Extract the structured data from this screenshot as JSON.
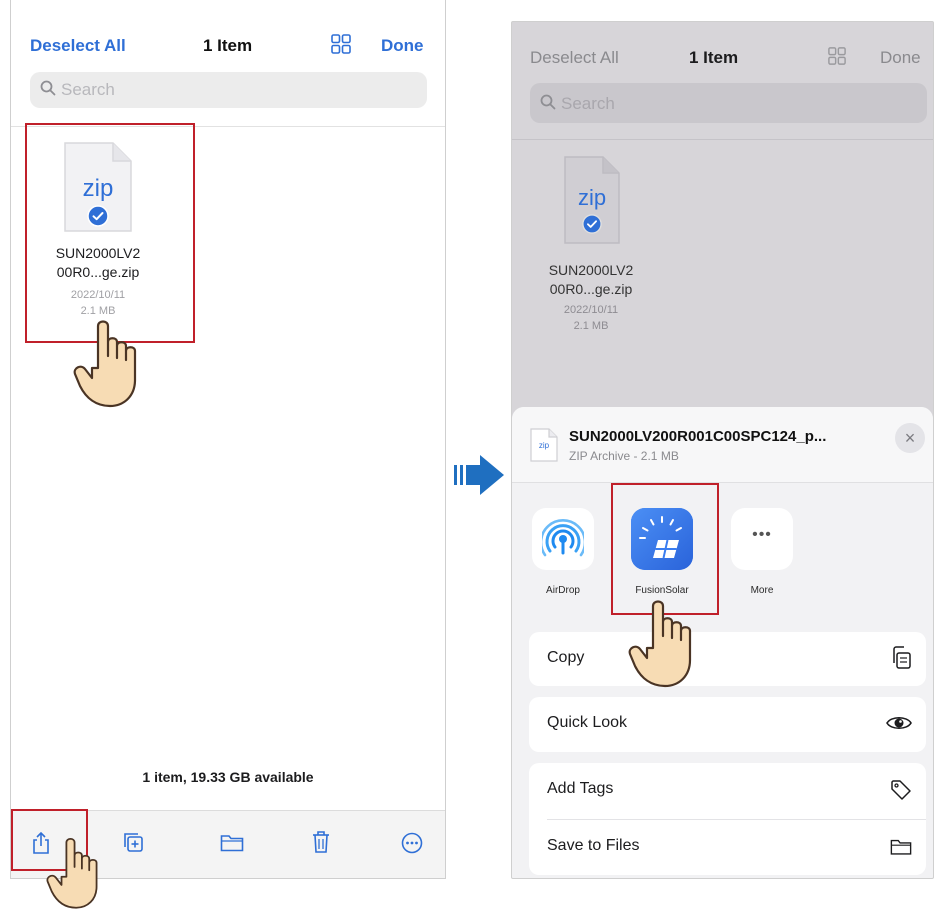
{
  "screen_left": {
    "nav": {
      "deselect_all": "Deselect All",
      "title": "1 Item",
      "done": "Done",
      "grid_icon": "grid-view-icon"
    },
    "search": {
      "placeholder": "Search"
    },
    "file": {
      "ext": "zip",
      "name_line1": "SUN2000LV2",
      "name_line2": "00R0...ge.zip",
      "date": "2022/10/11",
      "size": "2.1 MB"
    },
    "storage_text": "1 item, 19.33 GB available",
    "toolbar": [
      "share-icon",
      "duplicate-icon",
      "folder-icon",
      "trash-icon",
      "more-icon"
    ]
  },
  "screen_right": {
    "nav": {
      "deselect_all": "Deselect All",
      "title": "1 Item",
      "done": "Done"
    },
    "search": {
      "placeholder": "Search"
    },
    "file": {
      "ext": "zip",
      "name_line1": "SUN2000LV2",
      "name_line2": "00R0...ge.zip",
      "date": "2022/10/11",
      "size": "2.1 MB"
    },
    "sheet": {
      "file_title": "SUN2000LV200R001C00SPC124_p...",
      "file_subtitle": "ZIP Archive - 2.1 MB",
      "file_badge": "zip",
      "close_symbol": "×",
      "apps": [
        {
          "label": "AirDrop",
          "icon": "airdrop-icon"
        },
        {
          "label": "FusionSolar",
          "icon": "fusionsolar-app-icon"
        },
        {
          "label": "More",
          "icon": "more-dots-icon",
          "glyph": "•••"
        }
      ],
      "actions": [
        {
          "label": "Copy",
          "icon": "copy-icon"
        },
        {
          "label": "Quick Look",
          "icon": "eye-icon"
        },
        {
          "label": "Add Tags",
          "icon": "tag-icon"
        },
        {
          "label": "Save to Files",
          "icon": "folder-icon"
        }
      ]
    }
  },
  "colors": {
    "accent": "#2f6fd6",
    "highlight_box": "#c0202a",
    "arrow": "#1f6fc0",
    "fusion_blue": "#3a7df0"
  }
}
